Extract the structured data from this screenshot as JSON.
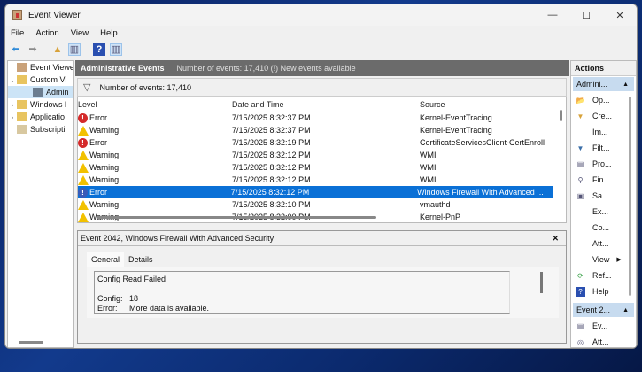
{
  "window": {
    "title": "Event Viewer",
    "controls": [
      "—",
      "☐",
      "✕"
    ]
  },
  "menu": [
    "File",
    "Action",
    "View",
    "Help"
  ],
  "toolbar": [
    {
      "icon": "back-arrow-icon",
      "glyph": "⬅",
      "color": "#2e8ad8"
    },
    {
      "icon": "forward-arrow-icon",
      "glyph": "➡",
      "color": "#8a8a8a"
    },
    {
      "icon": "up-folder-icon",
      "glyph": "▲",
      "color": "#d8a23a"
    },
    {
      "icon": "show-hide-tree-icon",
      "glyph": "▥",
      "color": "#557"
    },
    {
      "icon": "help-icon",
      "glyph": "?",
      "color": "#2a4fb0"
    },
    {
      "icon": "show-hide-action-icon",
      "glyph": "▥",
      "color": "#557"
    }
  ],
  "tree": [
    {
      "label": "Event Viewer (",
      "exp": "",
      "indent": 0,
      "icon": "event-viewer-icon"
    },
    {
      "label": "Custom Vi",
      "exp": "⌄",
      "indent": 0,
      "icon": "folder-icon"
    },
    {
      "label": "Admin",
      "exp": "",
      "indent": 1,
      "icon": "filter-icon",
      "selected": true
    },
    {
      "label": "Windows l",
      "exp": "›",
      "indent": 0,
      "icon": "windows-logs-folder-icon"
    },
    {
      "label": "Applicatio",
      "exp": "›",
      "indent": 0,
      "icon": "folder-icon"
    },
    {
      "label": "Subscripti",
      "exp": "",
      "indent": 0,
      "icon": "subscriptions-icon"
    }
  ],
  "main": {
    "header_title": "Administrative Events",
    "header_info": "Number of events: 17,410 (!) New events available",
    "filter_text": "Number of events: 17,410",
    "columns": [
      "Level",
      "Date and Time",
      "Source"
    ],
    "rows": [
      {
        "level": "Error",
        "date": "7/15/2025 8:32:37 PM",
        "source": "Kernel-EventTracing"
      },
      {
        "level": "Warning",
        "date": "7/15/2025 8:32:37 PM",
        "source": "Kernel-EventTracing"
      },
      {
        "level": "Error",
        "date": "7/15/2025 8:32:19 PM",
        "source": "CertificateServicesClient-CertEnroll"
      },
      {
        "level": "Warning",
        "date": "7/15/2025 8:32:12 PM",
        "source": "WMI"
      },
      {
        "level": "Warning",
        "date": "7/15/2025 8:32:12 PM",
        "source": "WMI"
      },
      {
        "level": "Warning",
        "date": "7/15/2025 8:32:12 PM",
        "source": "WMI"
      },
      {
        "level": "Error",
        "date": "7/15/2025 8:32:12 PM",
        "source": "Windows Firewall With Advanced ...",
        "selected": true
      },
      {
        "level": "Warning",
        "date": "7/15/2025 8:32:10 PM",
        "source": "vmauthd"
      },
      {
        "level": "Warning",
        "date": "7/15/2025 8:32:00 PM",
        "source": "Kernel-PnP"
      }
    ]
  },
  "detail": {
    "title": "Event 2042, Windows Firewall With Advanced Security",
    "close": "✕",
    "tabs": [
      "General",
      "Details"
    ],
    "message_title": "Config Read Failed",
    "fields": [
      {
        "k": "Config:",
        "v": "18"
      },
      {
        "k": "Error:",
        "v": "More data is available."
      }
    ]
  },
  "actions": {
    "title": "Actions",
    "section1": "Admini...",
    "items": [
      {
        "label": "Op...",
        "icon": "open-folder-icon",
        "glyph": "📂"
      },
      {
        "label": "Cre...",
        "icon": "create-filter-icon",
        "glyph": "▼"
      },
      {
        "label": "Im...",
        "icon": "",
        "glyph": ""
      },
      {
        "label": "Filt...",
        "icon": "filter-icon",
        "glyph": "▼"
      },
      {
        "label": "Pro...",
        "icon": "properties-icon",
        "glyph": "▤"
      },
      {
        "label": "Fin...",
        "icon": "find-binoculars-icon",
        "glyph": "⚲"
      },
      {
        "label": "Sa...",
        "icon": "save-icon",
        "glyph": "▣"
      },
      {
        "label": "Ex...",
        "icon": "",
        "glyph": ""
      },
      {
        "label": "Co...",
        "icon": "",
        "glyph": ""
      },
      {
        "label": "Att...",
        "icon": "",
        "glyph": ""
      },
      {
        "label": "View",
        "icon": "",
        "glyph": "",
        "submenu": "▶"
      },
      {
        "label": "Ref...",
        "icon": "refresh-icon",
        "glyph": "⟳"
      },
      {
        "label": "Help",
        "icon": "help-icon",
        "glyph": "?"
      }
    ],
    "section2": "Event 2...",
    "items2": [
      {
        "label": "Ev...",
        "icon": "event-properties-icon",
        "glyph": "▤"
      },
      {
        "label": "Att...",
        "icon": "attach-task-icon",
        "glyph": "◎"
      }
    ]
  },
  "colors": {
    "selection": "#0a70d6",
    "header": "#6b6b6b",
    "action_section": "#c7dbef",
    "error": "#d42a2a",
    "warning": "#f2c100"
  }
}
